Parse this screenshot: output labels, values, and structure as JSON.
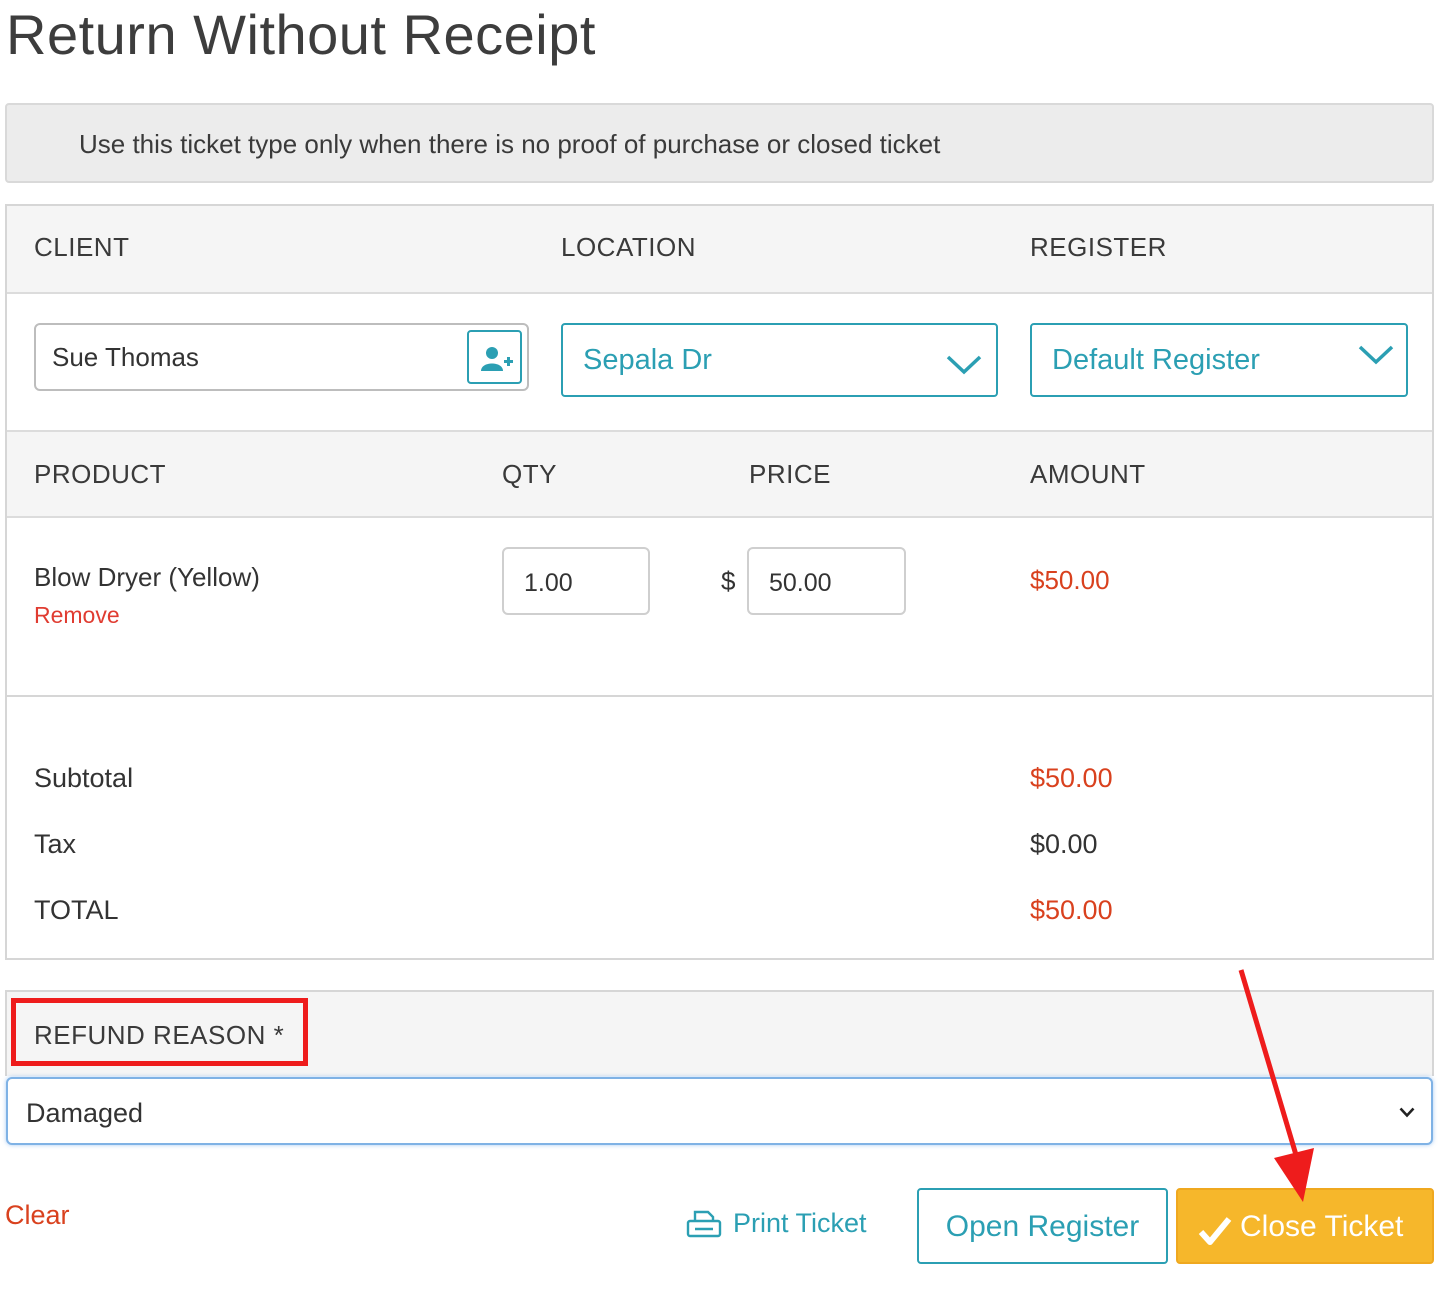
{
  "page_title": "Return Without Receipt",
  "notice": "Use this ticket type only when there is no proof of purchase or closed ticket",
  "headers": {
    "client": "CLIENT",
    "location": "LOCATION",
    "register": "REGISTER",
    "product": "PRODUCT",
    "qty": "QTY",
    "price": "PRICE",
    "amount": "AMOUNT"
  },
  "client": {
    "name": "Sue Thomas",
    "add_icon": "add-user-icon"
  },
  "location": {
    "selected": "Sepala Dr"
  },
  "register": {
    "selected": "Default Register"
  },
  "line_item": {
    "product": "Blow Dryer (Yellow)",
    "remove_label": "Remove",
    "qty": "1.00",
    "currency_symbol": "$",
    "price": "50.00",
    "amount": "$50.00"
  },
  "summary": {
    "subtotal_label": "Subtotal",
    "subtotal": "$50.00",
    "tax_label": "Tax",
    "tax": "$0.00",
    "total_label": "TOTAL",
    "total": "$50.00"
  },
  "refund": {
    "label": "REFUND REASON *",
    "selected": "Damaged"
  },
  "actions": {
    "clear": "Clear",
    "print": "Print Ticket",
    "open_register": "Open Register",
    "close_ticket": "Close Ticket"
  },
  "colors": {
    "teal": "#2b9fb3",
    "amount_red": "#d9411e",
    "primary_orange": "#f6b72b",
    "annotation_red": "#ee1c1c"
  }
}
